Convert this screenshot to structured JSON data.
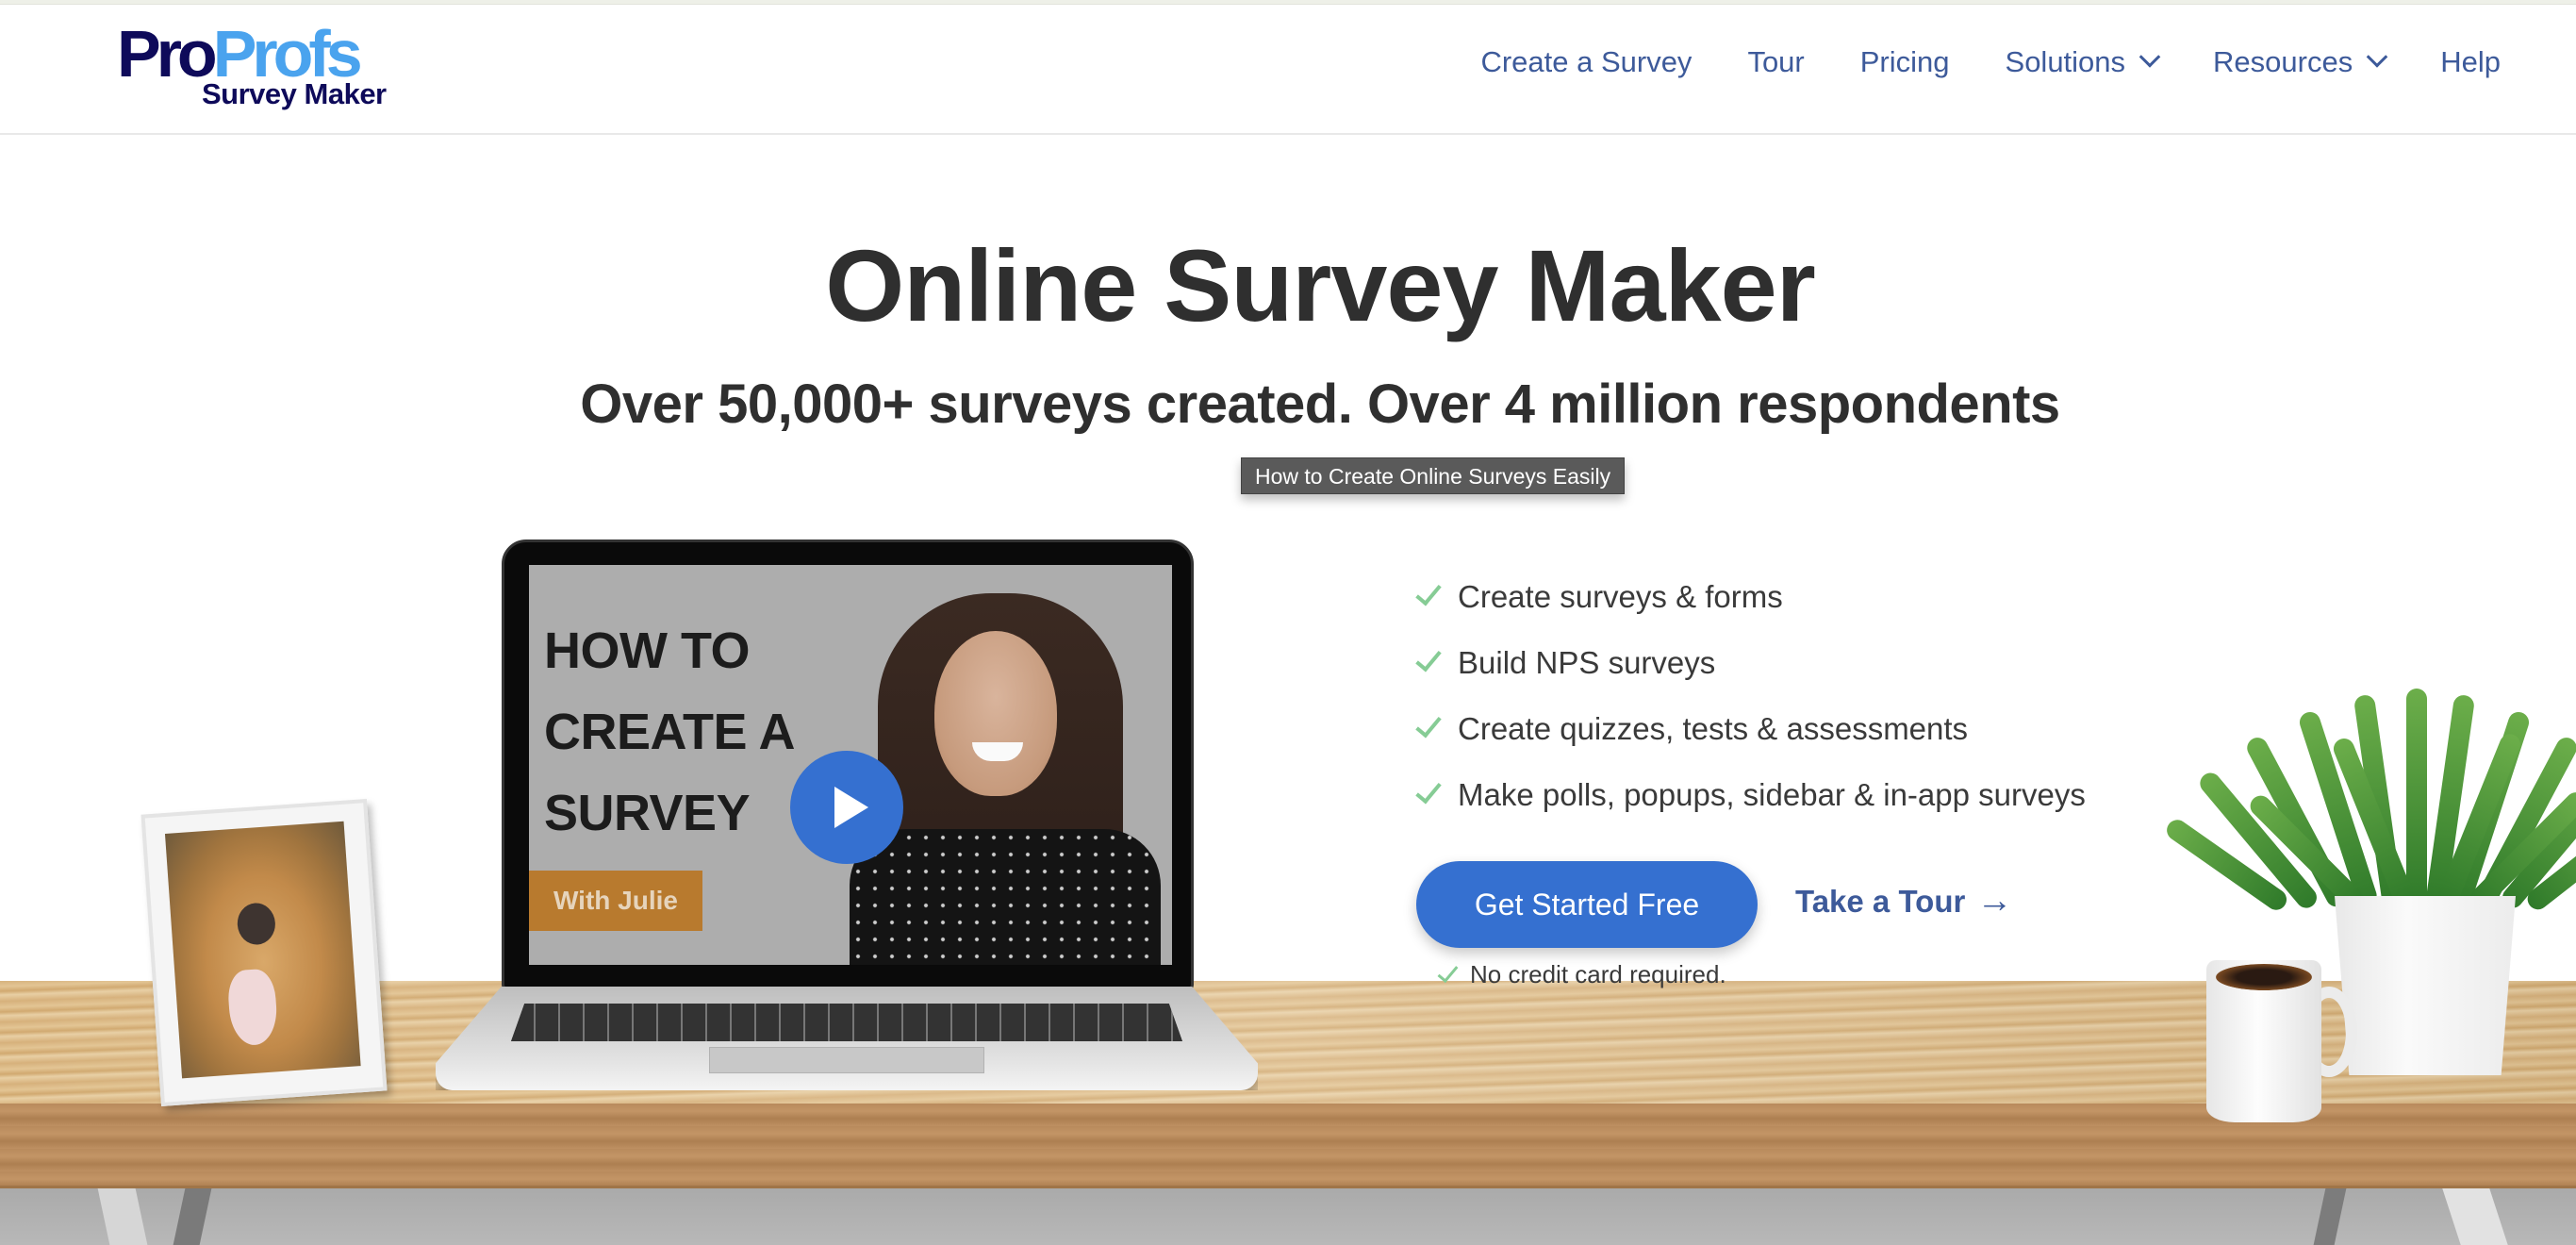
{
  "header": {
    "logo": {
      "pro": "Pro",
      "profs": "Profs",
      "sub": "Survey Maker"
    },
    "nav": [
      {
        "label": "Create a Survey",
        "dropdown": false
      },
      {
        "label": "Tour",
        "dropdown": false
      },
      {
        "label": "Pricing",
        "dropdown": false
      },
      {
        "label": "Solutions",
        "dropdown": true
      },
      {
        "label": "Resources",
        "dropdown": true
      },
      {
        "label": "Help",
        "dropdown": false
      }
    ]
  },
  "hero": {
    "title": "Online Survey Maker",
    "subtitle": "Over 50,000+ surveys created. Over 4 million respondents",
    "tooltip": "How to Create Online Surveys Easily"
  },
  "video": {
    "title": "HOW TO\nCREATE A\nSURVEY",
    "badge": "With Julie",
    "play_icon": "play-icon"
  },
  "features": [
    "Create surveys & forms",
    "Build NPS surveys",
    "Create quizzes, tests & assessments",
    "Make polls, popups, sidebar & in-app surveys"
  ],
  "cta": {
    "primary_label": "Get Started Free",
    "secondary_label": "Take a Tour",
    "secondary_arrow": "→",
    "note": "No credit card required."
  },
  "colors": {
    "logo_dark": "#0e0a5a",
    "logo_light": "#4aa3ee",
    "nav_text": "#3d5a9a",
    "primary_button": "#3570d0",
    "check_green": "#86cc95",
    "heading_text": "#2f2f2f",
    "badge_orange": "#b87a2e"
  }
}
